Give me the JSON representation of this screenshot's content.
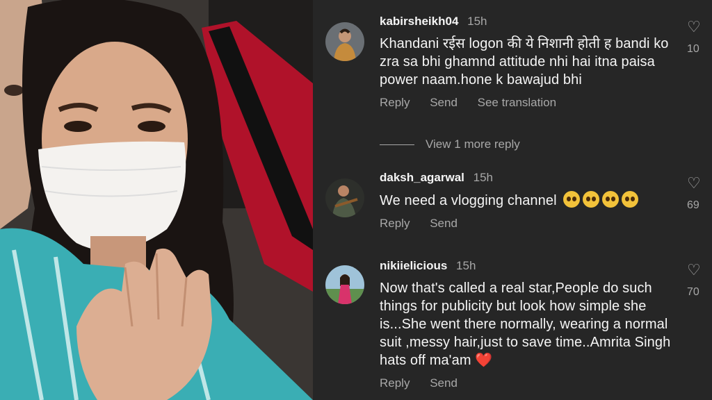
{
  "comments": [
    {
      "username": "kabirsheikh04",
      "time": "15h",
      "text": "Khandani रईस logon की ये निशानी होती ह bandi ko zra sa bhi ghamnd attitude nhi hai itna paisa power naam.hone k bawajud bhi",
      "actions": [
        "Reply",
        "Send",
        "See translation"
      ],
      "like_count": "10",
      "avatar_icon": "avatar-man-icon"
    },
    {
      "username": "daksh_agarwal",
      "time": "15h",
      "text": "We need a vlogging channel",
      "emoji": [
        "pleading-face",
        "pleading-face",
        "pleading-face",
        "pleading-face"
      ],
      "actions": [
        "Reply",
        "Send"
      ],
      "like_count": "69",
      "avatar_icon": "avatar-guitarist-icon"
    },
    {
      "username": "nikiielicious",
      "time": "15h",
      "text": "Now that's called a real star,People do such things for publicity but look how simple she is...She went there normally, wearing a normal suit ,messy hair,just to save time..Amrita Singh hats off ma'am",
      "trailing_emoji": "❤️",
      "actions": [
        "Reply",
        "Send"
      ],
      "like_count": "70",
      "avatar_icon": "avatar-woman-icon"
    }
  ],
  "view_more": "View 1 more reply",
  "colors": {
    "background": "#262626",
    "secondary_text": "#a8a8a8",
    "heart": "#e0243b"
  }
}
